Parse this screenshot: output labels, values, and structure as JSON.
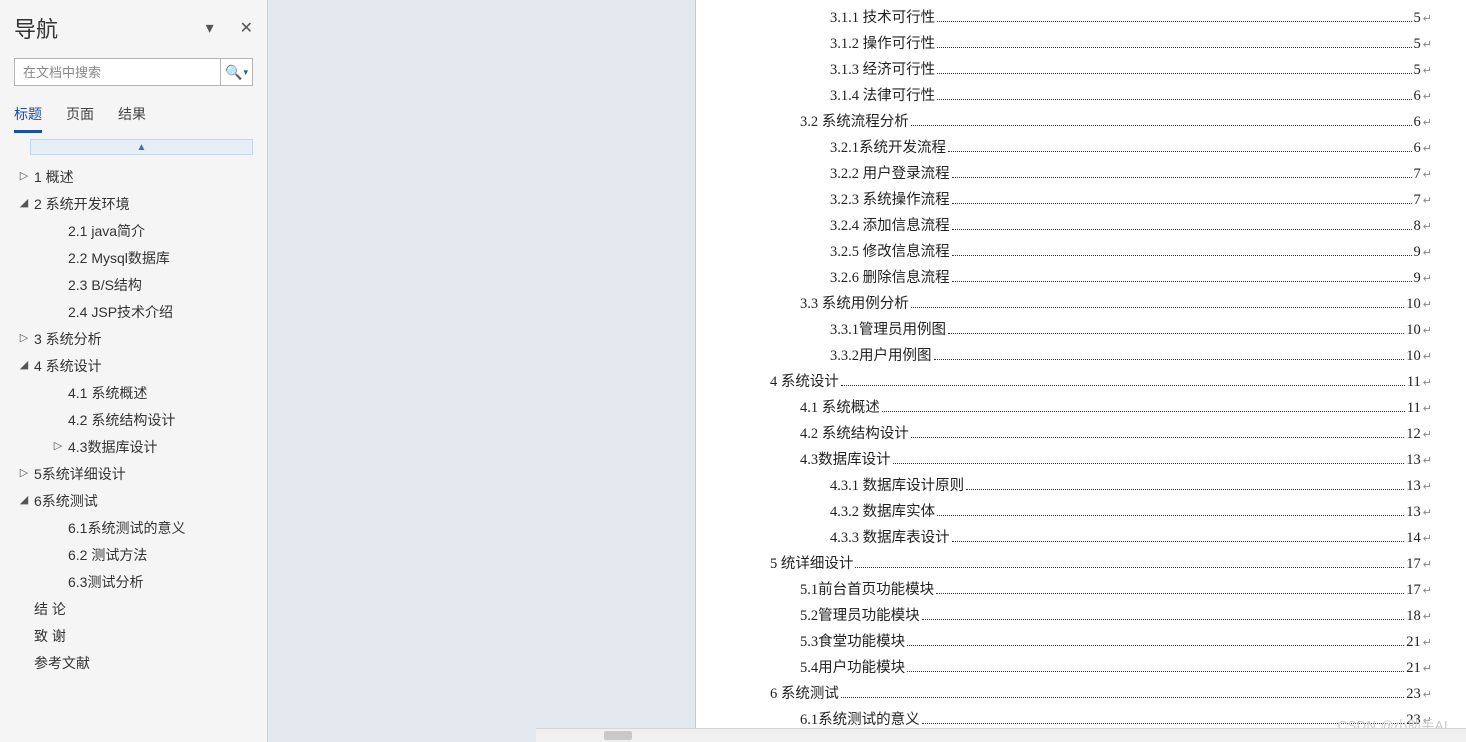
{
  "nav": {
    "title": "导航",
    "search_placeholder": "在文档中搜索",
    "tabs": {
      "headings": "标题",
      "pages": "页面",
      "results": "结果"
    },
    "collapse_glyph": "▲"
  },
  "outline": [
    {
      "level": 1,
      "arrow": "▷",
      "label": "1 概述"
    },
    {
      "level": 1,
      "arrow": "◢",
      "label": "2 系统开发环境"
    },
    {
      "level": 2,
      "arrow": "",
      "label": "2.1 java简介"
    },
    {
      "level": 2,
      "arrow": "",
      "label": "2.2 Mysql数据库"
    },
    {
      "level": 2,
      "arrow": "",
      "label": "2.3 B/S结构"
    },
    {
      "level": 2,
      "arrow": "",
      "label": "2.4 JSP技术介绍"
    },
    {
      "level": 1,
      "arrow": "▷",
      "label": "3 系统分析"
    },
    {
      "level": 1,
      "arrow": "◢",
      "label": "4 系统设计"
    },
    {
      "level": 2,
      "arrow": "",
      "label": "4.1 系统概述"
    },
    {
      "level": 2,
      "arrow": "",
      "label": "4.2 系统结构设计"
    },
    {
      "level": 2,
      "arrow": "▷",
      "label": "4.3数据库设计"
    },
    {
      "level": 1,
      "arrow": "▷",
      "label": "5系统详细设计"
    },
    {
      "level": 1,
      "arrow": "◢",
      "label": "6系统测试"
    },
    {
      "level": 2,
      "arrow": "",
      "label": "6.1系统测试的意义"
    },
    {
      "level": 2,
      "arrow": "",
      "label": "6.2 测试方法"
    },
    {
      "level": 2,
      "arrow": "",
      "label": "6.3测试分析"
    },
    {
      "level": 1,
      "arrow": "",
      "label": "结    论"
    },
    {
      "level": 1,
      "arrow": "",
      "label": "致    谢"
    },
    {
      "level": 1,
      "arrow": "",
      "label": "参考文献"
    }
  ],
  "toc": [
    {
      "indent": 3,
      "title": "3.1.1 技术可行性",
      "page": "5"
    },
    {
      "indent": 3,
      "title": "3.1.2 操作可行性",
      "page": "5"
    },
    {
      "indent": 3,
      "title": "3.1.3 经济可行性",
      "page": "5"
    },
    {
      "indent": 3,
      "title": "3.1.4 法律可行性",
      "page": "6"
    },
    {
      "indent": 2,
      "title": "3.2 系统流程分析",
      "page": "6"
    },
    {
      "indent": 3,
      "title": "3.2.1系统开发流程",
      "page": "6"
    },
    {
      "indent": 3,
      "title": "3.2.2 用户登录流程",
      "page": "7"
    },
    {
      "indent": 3,
      "title": "3.2.3 系统操作流程",
      "page": "7"
    },
    {
      "indent": 3,
      "title": "3.2.4 添加信息流程",
      "page": "8"
    },
    {
      "indent": 3,
      "title": "3.2.5 修改信息流程",
      "page": "9"
    },
    {
      "indent": 3,
      "title": "3.2.6 删除信息流程",
      "page": "9"
    },
    {
      "indent": 2,
      "title": "3.3 系统用例分析",
      "page": "10"
    },
    {
      "indent": 3,
      "title": "3.3.1管理员用例图",
      "page": "10"
    },
    {
      "indent": 3,
      "title": "3.3.2用户用例图",
      "page": "10"
    },
    {
      "indent": 1,
      "title": "4 系统设计",
      "page": "11"
    },
    {
      "indent": 2,
      "title": "4.1 系统概述",
      "page": "11"
    },
    {
      "indent": 2,
      "title": "4.2 系统结构设计",
      "page": "12"
    },
    {
      "indent": 2,
      "title": "4.3数据库设计",
      "page": "13"
    },
    {
      "indent": 3,
      "title": "4.3.1 数据库设计原则",
      "page": "13"
    },
    {
      "indent": 3,
      "title": "4.3.2 数据库实体",
      "page": "13"
    },
    {
      "indent": 3,
      "title": "4.3.3 数据库表设计",
      "page": "14"
    },
    {
      "indent": 1,
      "title": "5 统详细设计",
      "page": "17"
    },
    {
      "indent": 2,
      "title": "5.1前台首页功能模块",
      "page": "17"
    },
    {
      "indent": 2,
      "title": "5.2管理员功能模块",
      "page": "18"
    },
    {
      "indent": 2,
      "title": "5.3食堂功能模块",
      "page": "21"
    },
    {
      "indent": 2,
      "title": "5.4用户功能模块",
      "page": "21"
    },
    {
      "indent": 1,
      "title": "6 系统测试",
      "page": "23"
    },
    {
      "indent": 2,
      "title": "6.1系统测试的意义",
      "page": "23"
    }
  ],
  "watermark": "CSDN @小助手AI"
}
